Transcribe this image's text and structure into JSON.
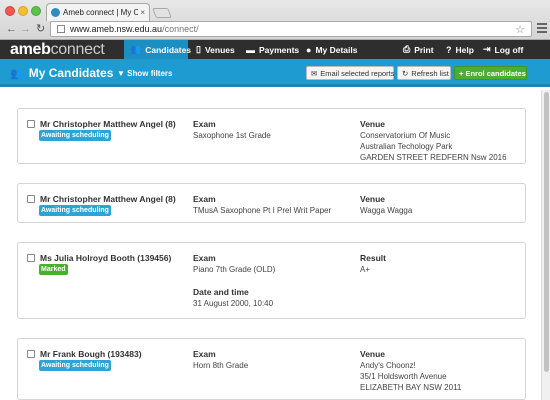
{
  "browser": {
    "tab_title": "Ameb connect | My Candid",
    "tab_close": "×",
    "url_host": "www.ameb.nsw.edu.au",
    "url_path": "/connect/"
  },
  "app": {
    "logo_bold": "ameb",
    "logo_light": "connect",
    "nav": {
      "candidates": "Candidates",
      "venues": "Venues",
      "payments": "Payments",
      "my_details": "My Details",
      "print": "Print",
      "help": "Help",
      "log_off": "Log off"
    }
  },
  "toolbar": {
    "title": "My Candidates",
    "show_filters": "Show filters",
    "email_selected": "Email selected reports",
    "refresh": "Refresh list",
    "enrol": "+ Enrol candidates"
  },
  "colors": {
    "accent": "#1e9bd0",
    "header": "#2e2e2e",
    "enrol_button": "#4cae2e",
    "badge_scheduling": "#2ba5d5",
    "badge_marked": "#48b02b"
  },
  "candidates": [
    {
      "name": "Mr Christopher Matthew Angel (8)",
      "status": "Awaiting scheduling",
      "exam_label": "Exam",
      "exam": "Saxophone 1st Grade",
      "venue_label": "Venue",
      "venue_lines": [
        "Conservatorium Of Music",
        "Australian Techology Park",
        "GARDEN STREET REDFERN Nsw 2016"
      ]
    },
    {
      "name": "Mr Christopher Matthew Angel (8)",
      "status": "Awaiting scheduling",
      "exam_label": "Exam",
      "exam": "TMusA Saxophone Pt I Prel Writ Paper",
      "venue_label": "Venue",
      "venue_lines": [
        "Wagga Wagga"
      ]
    },
    {
      "name": "Ms Julia Holroyd Booth (139456)",
      "status": "Marked",
      "exam_label": "Exam",
      "exam": "Piano 7th Grade (OLD)",
      "result_label": "Result",
      "result": "A+",
      "date_label": "Date and time",
      "date": "31 August 2000, 10:40"
    },
    {
      "name": "Mr Frank Bough (193483)",
      "status": "Awaiting scheduling",
      "exam_label": "Exam",
      "exam": "Horn 8th Grade",
      "venue_label": "Venue",
      "venue_lines": [
        "Andy's Choonz!",
        "35/1 Holdsworth Avenue",
        "ELIZABETH BAY NSW 2011"
      ]
    }
  ]
}
